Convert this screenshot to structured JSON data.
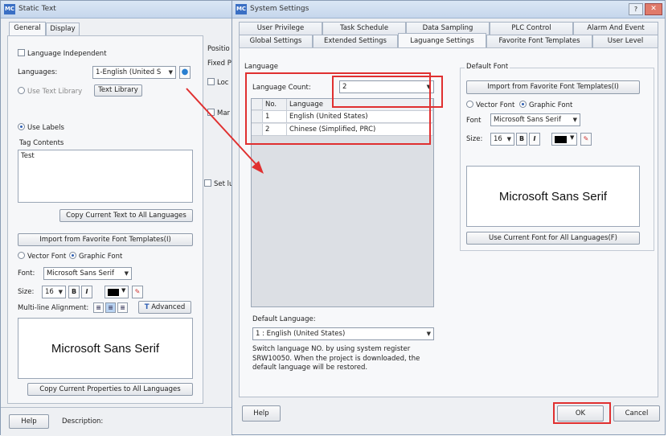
{
  "left_window": {
    "title": "Static Text",
    "tabs": [
      "General",
      "Display"
    ],
    "language_independent": "Language Independent",
    "languages_label": "Languages:",
    "languages_value": "1-English (United S",
    "use_text_library": "Use Text Library",
    "text_library_button": "Text Library",
    "use_labels": "Use Labels",
    "tag_contents_label": "Tag Contents",
    "tag_contents_value": "Test",
    "copy_text_button": "Copy Current Text to All Languages",
    "import_button": "Import from Favorite Font Templates(I)",
    "vector_font": "Vector Font",
    "graphic_font": "Graphic Font",
    "font_label": "Font:",
    "font_value": "Microsoft Sans Serif",
    "size_label": "Size:",
    "size_value": "16",
    "bold": "B",
    "italic": "I",
    "multiline_label": "Multi-line Alignment:",
    "advanced_button": "Advanced",
    "preview_text": "Microsoft Sans Serif",
    "copy_props_button": "Copy Current Properties to All Languages",
    "help_button": "Help",
    "description_label": "Description:",
    "position_label": "Positio",
    "fixed_label": "Fixed P",
    "lock_label": "Loc",
    "mar_label": "Mar",
    "set_label": "Set lu"
  },
  "dialog": {
    "title": "System Settings",
    "tabs_row1": [
      "User Privilege",
      "Task Schedule",
      "Data Sampling",
      "PLC Control",
      "Alarm And Event"
    ],
    "tabs_row2": [
      "Global Settings",
      "Extended Settings",
      "Laguange Settings",
      "Favorite Font Templates",
      "User Level"
    ],
    "language_group": "Language",
    "language_count_label": "Language Count:",
    "language_count_value": "2",
    "table_headers": [
      "No.",
      "Language"
    ],
    "table_rows": [
      {
        "no": "1",
        "language": "English (United States)"
      },
      {
        "no": "2",
        "language": "Chinese (Simplified, PRC)"
      }
    ],
    "default_language_label": "Default Language:",
    "default_language_value": "1 : English (United States)",
    "note": "Switch language NO. by using system register SRW10050. When the project is downloaded, the default language will be restored.",
    "default_font_group": "Default Font",
    "import_button": "Import from Favorite Font Templates(I)",
    "vector_font": "Vector Font",
    "graphic_font": "Graphic Font",
    "font_label": "Font",
    "font_value": "Microsoft Sans Serif",
    "size_label": "Size:",
    "size_value": "16",
    "bold": "B",
    "italic": "I",
    "preview_text": "Microsoft Sans Serif",
    "use_font_button": "Use Current Font for All Languages(F)",
    "help_button": "Help",
    "ok_button": "OK",
    "cancel_button": "Cancel"
  },
  "colors": {
    "highlight": "#e03030",
    "accent": "#3a6fc4"
  }
}
